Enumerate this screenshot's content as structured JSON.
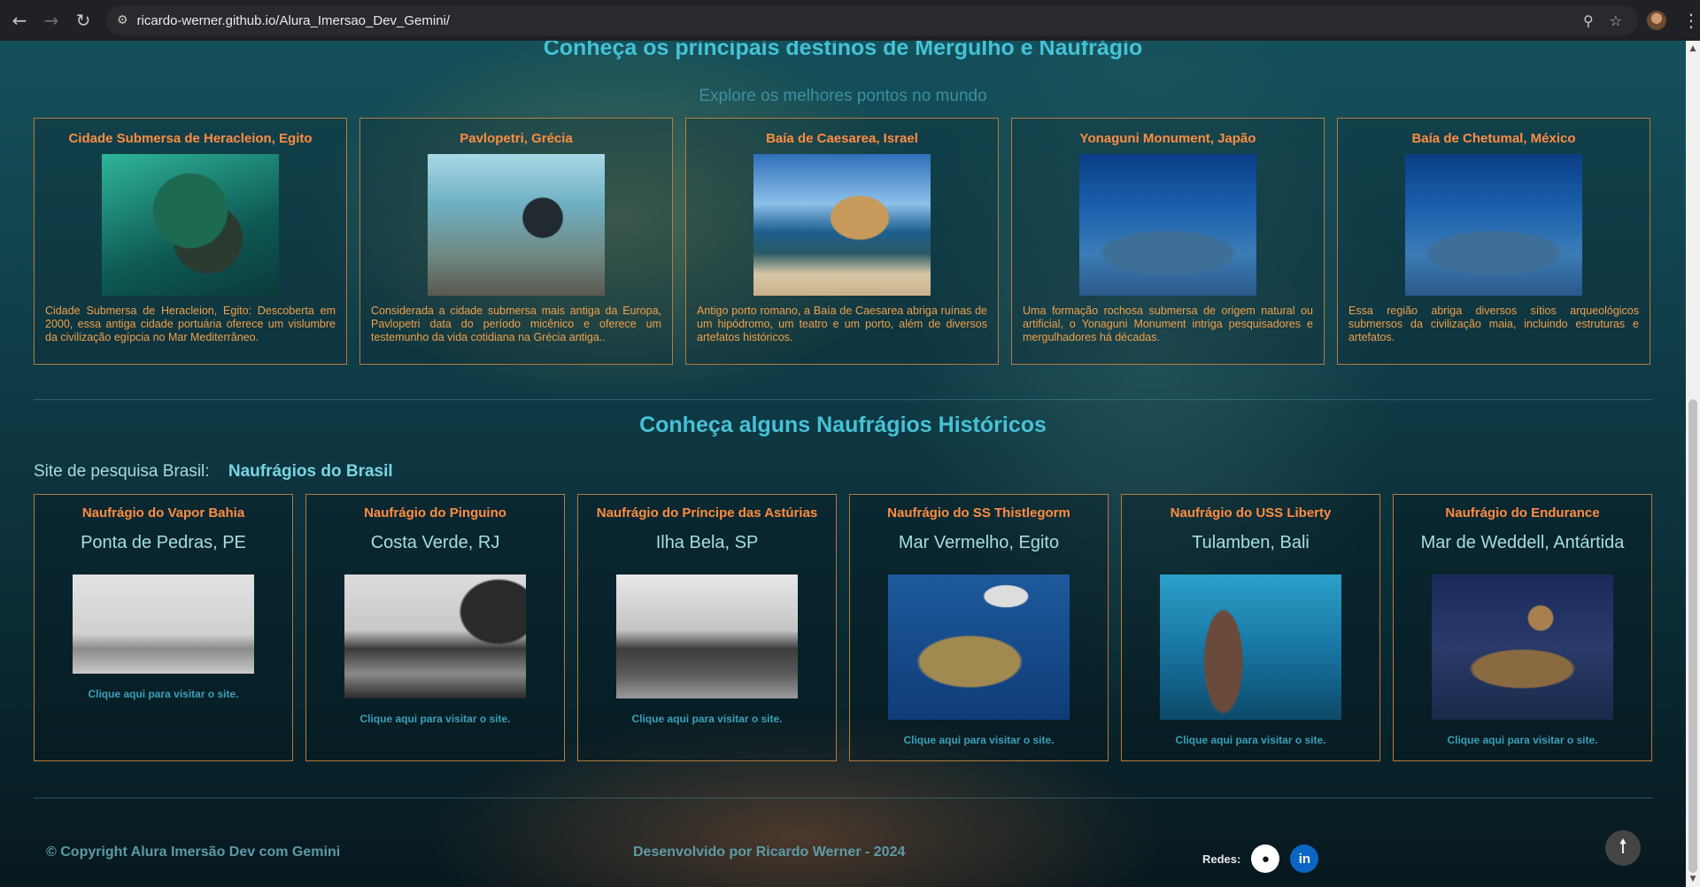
{
  "browser": {
    "url": "ricardo-werner.github.io/Alura_Imersao_Dev_Gemini/"
  },
  "destinations": {
    "title": "Conheça os principais destinos de Mergulho e Naufrágio",
    "subtitle": "Explore os melhores pontos no mundo",
    "cards": [
      {
        "title": "Cidade Submersa de Heracleion, Egito",
        "text": "Cidade Submersa de Heracleion, Egito: Descoberta em 2000, essa antiga cidade portuária oferece um vislumbre da civilização egípcia no Mar Mediterrâneo."
      },
      {
        "title": "Pavlopetri, Grécia",
        "text": "Considerada a cidade submersa mais antiga da Europa, Pavlopetri data do período micênico e oferece um testemunho da vida cotidiana na Grécia antiga.."
      },
      {
        "title": "Baía de Caesarea, Israel",
        "text": "Antigo porto romano, a Baía de Caesarea abriga ruínas de um hipódromo, um teatro e um porto, além de diversos artefatos históricos."
      },
      {
        "title": "Yonaguni Monument, Japão",
        "text": "Uma formação rochosa submersa de origem natural ou artificial, o Yonaguni Monument intriga pesquisadores e mergulhadores há décadas."
      },
      {
        "title": "Baía de Chetumal, México",
        "text": "Essa região abriga diversos sítios arqueológicos submersos da civilização maia, incluindo estruturas e artefatos."
      }
    ]
  },
  "wrecks": {
    "title": "Conheça alguns Naufrágios Históricos",
    "research_label": "Site de pesquisa Brasil:",
    "research_link": "Naufrágios do Brasil",
    "cards": [
      {
        "title": "Naufrágio do Vapor Bahia",
        "location": "Ponta de Pedras, PE",
        "link": "Clique aqui para visitar o site."
      },
      {
        "title": "Naufrágio do Pinguino",
        "location": "Costa Verde, RJ",
        "link": "Clique aqui para visitar o site."
      },
      {
        "title": "Naufrágio do Príncipe das Astúrias",
        "location": "Ilha Bela, SP",
        "link": "Clique aqui para visitar o site."
      },
      {
        "title": "Naufrágio do SS Thistlegorm",
        "location": "Mar Vermelho, Egito",
        "link": "Clique aqui para visitar o site."
      },
      {
        "title": "Naufrágio do USS Liberty",
        "location": "Tulamben, Bali",
        "link": "Clique aqui para visitar o site."
      },
      {
        "title": "Naufrágio do Endurance",
        "location": "Mar de Weddell, Antártida",
        "link": "Clique aqui para visitar o site."
      }
    ]
  },
  "footer": {
    "copyright": "© Copyright Alura Imersão Dev com Gemini",
    "developer": "Desenvolvido por Ricardo Werner - 2024",
    "social_label": "Redes:"
  },
  "icons": {
    "back": "arrow-left-icon",
    "forward": "arrow-right-icon",
    "reload": "reload-icon",
    "site_info": "site-info-icon",
    "zoom": "zoom-icon",
    "bookmark": "star-icon",
    "menu": "kebab-menu-icon",
    "github": "github-icon",
    "linkedin": "linkedin-icon",
    "back_to_top": "arrow-up-icon"
  }
}
